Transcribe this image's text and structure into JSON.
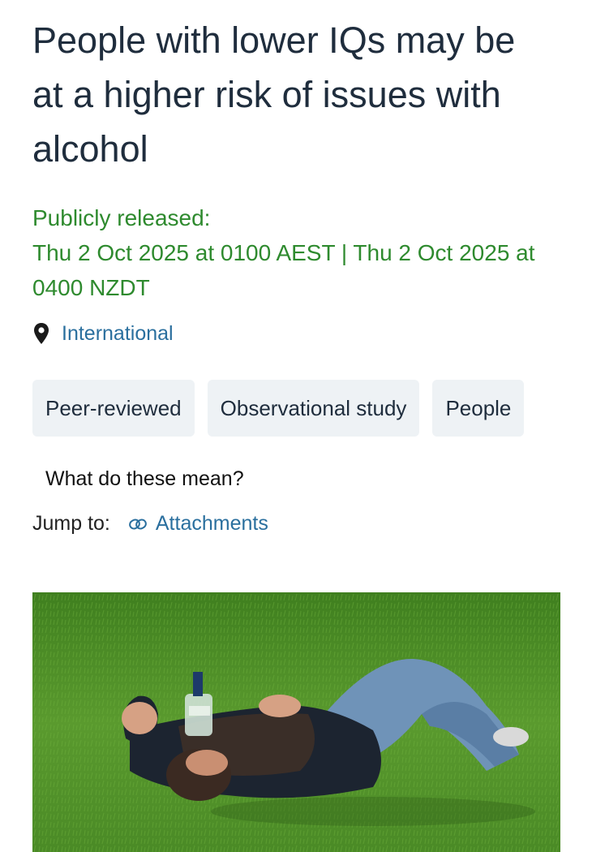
{
  "article": {
    "title": "People with lower IQs may be at a higher risk of issues with alcohol",
    "released_label": "Publicly released:",
    "released_dates": "Thu 2 Oct 2025 at 0100 AEST | Thu 2 Oct 2025 at 0400 NZDT",
    "location": "International",
    "location_icon": "map-pin-icon"
  },
  "tags": [
    {
      "label": "Peer-reviewed"
    },
    {
      "label": "Observational study"
    },
    {
      "label": "People"
    }
  ],
  "help_link": "What do these mean?",
  "jump": {
    "label": "Jump to:",
    "link_icon": "link-icon",
    "attachments": "Attachments"
  },
  "image": {
    "subject": "man lying on grass with a bottle"
  },
  "colors": {
    "title": "#1f2d3d",
    "released": "#2e8a2e",
    "link": "#2a6f9e",
    "tag_bg": "#eef2f5",
    "grass": "#4f8f2c"
  }
}
